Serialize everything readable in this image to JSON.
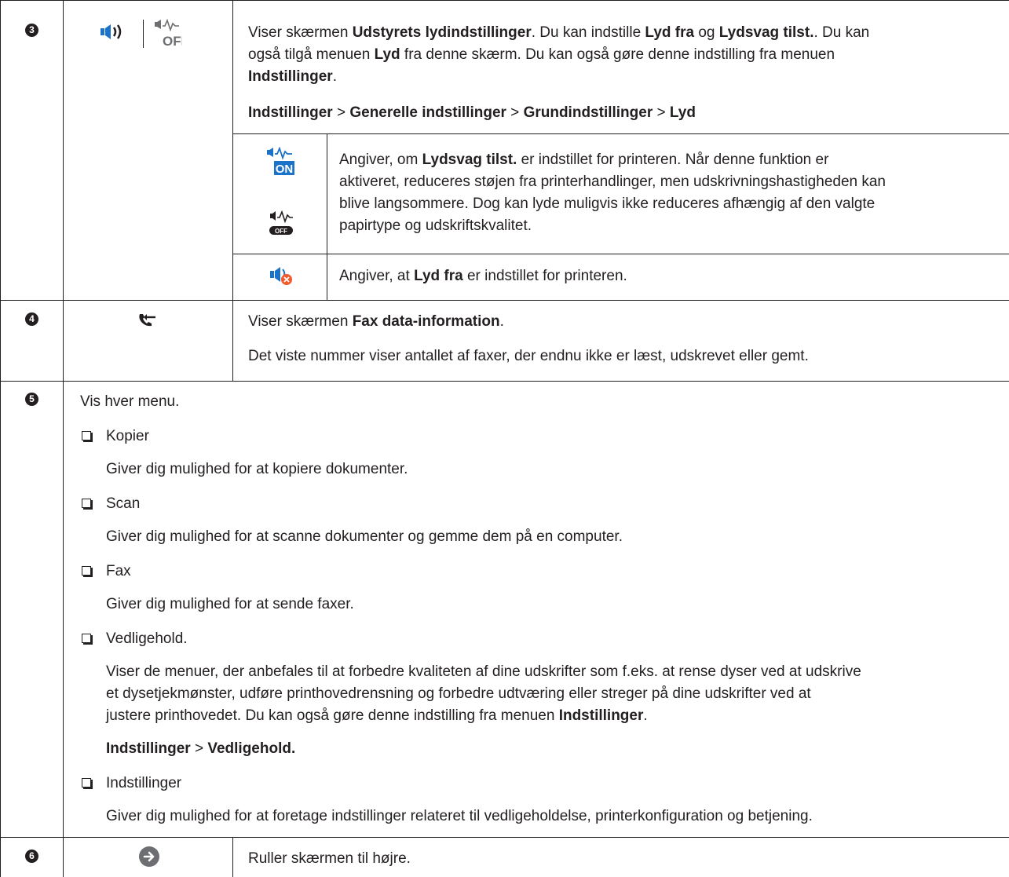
{
  "rows": [
    {
      "num": "3",
      "intro": {
        "l1_a": "Viser skærmen ",
        "l1_b": "Udstyrets lydindstillinger",
        "l1_c": ". Du kan indstille ",
        "l1_d": "Lyd fra",
        "l1_e": " og ",
        "l1_f": "Lydsvag tilst.",
        "l1_g": ". Du kan",
        "l2_a": "også tilgå menuen ",
        "l2_b": "Lyd",
        "l2_c": " fra denne skærm. Du kan også gøre denne indstilling fra menuen",
        "l3_a": "Indstillinger",
        "l3_b": "."
      },
      "path": {
        "a": "Indstillinger",
        "sep1": " > ",
        "b": "Generelle indstillinger",
        "sep2": " > ",
        "c": "Grundindstillinger",
        "sep3": " > ",
        "d": "Lyd"
      },
      "sub1": {
        "icon_on_text": "ON",
        "icon_off_text": "OFF",
        "l1_a": "Angiver, om ",
        "l1_b": "Lydsvag tilst.",
        "l1_c": " er indstillet for printeren. Når denne funktion er",
        "l2": "aktiveret, reduceres støjen fra printerhandlinger, men udskrivningshastigheden kan",
        "l3": "blive langsommere. Dog kan lyde muligvis ikke reduceres afhængig af den valgte",
        "l4": "papirtype og udskriftskvalitet."
      },
      "sub2": {
        "a": "Angiver, at ",
        "b": "Lyd fra",
        "c": " er indstillet for printeren."
      }
    },
    {
      "num": "4",
      "p1_a": "Viser skærmen ",
      "p1_b": "Fax data-information",
      "p1_c": ".",
      "p2": "Det viste nummer viser antallet af faxer, der endnu ikke er læst, udskrevet eller gemt."
    },
    {
      "num": "5",
      "intro": "Vis hver menu.",
      "items": [
        {
          "title": "Kopier",
          "desc": "Giver dig mulighed for at kopiere dokumenter."
        },
        {
          "title": "Scan",
          "desc": "Giver dig mulighed for at scanne dokumenter og gemme dem på en computer."
        },
        {
          "title": "Fax",
          "desc": "Giver dig mulighed for at sende faxer."
        },
        {
          "title": "Vedligehold.",
          "desc1": "Viser de menuer, der anbefales til at forbedre kvaliteten af dine udskrifter som f.eks. at rense dyser ved at udskrive",
          "desc2": "et dysetjekmønster, udføre printhovedrensning og forbedre udtværing eller streger på dine udskrifter ved at",
          "desc3_a": "justere printhovedet. Du kan også gøre denne indstilling fra menuen ",
          "desc3_b": "Indstillinger",
          "desc3_c": ".",
          "path_a": "Indstillinger",
          "path_sep": " > ",
          "path_b": "Vedligehold."
        },
        {
          "title": "Indstillinger",
          "desc": "Giver dig mulighed for at foretage indstillinger relateret til vedligeholdelse, printerkonfiguration og betjening."
        }
      ]
    },
    {
      "num": "6",
      "text": "Ruller skærmen til højre."
    }
  ],
  "icons": [
    "speaker-icon",
    "quiet-mode-off-icon",
    "quiet-mode-on-icon",
    "quiet-mode-off-small-icon",
    "sound-muted-icon",
    "fax-data-icon",
    "scroll-right-arrow-icon"
  ],
  "colors": {
    "accent_blue": "#1a73c8",
    "text": "#231f20",
    "muted_red": "#f15a29",
    "arrow_gray": "#6d6e71"
  }
}
